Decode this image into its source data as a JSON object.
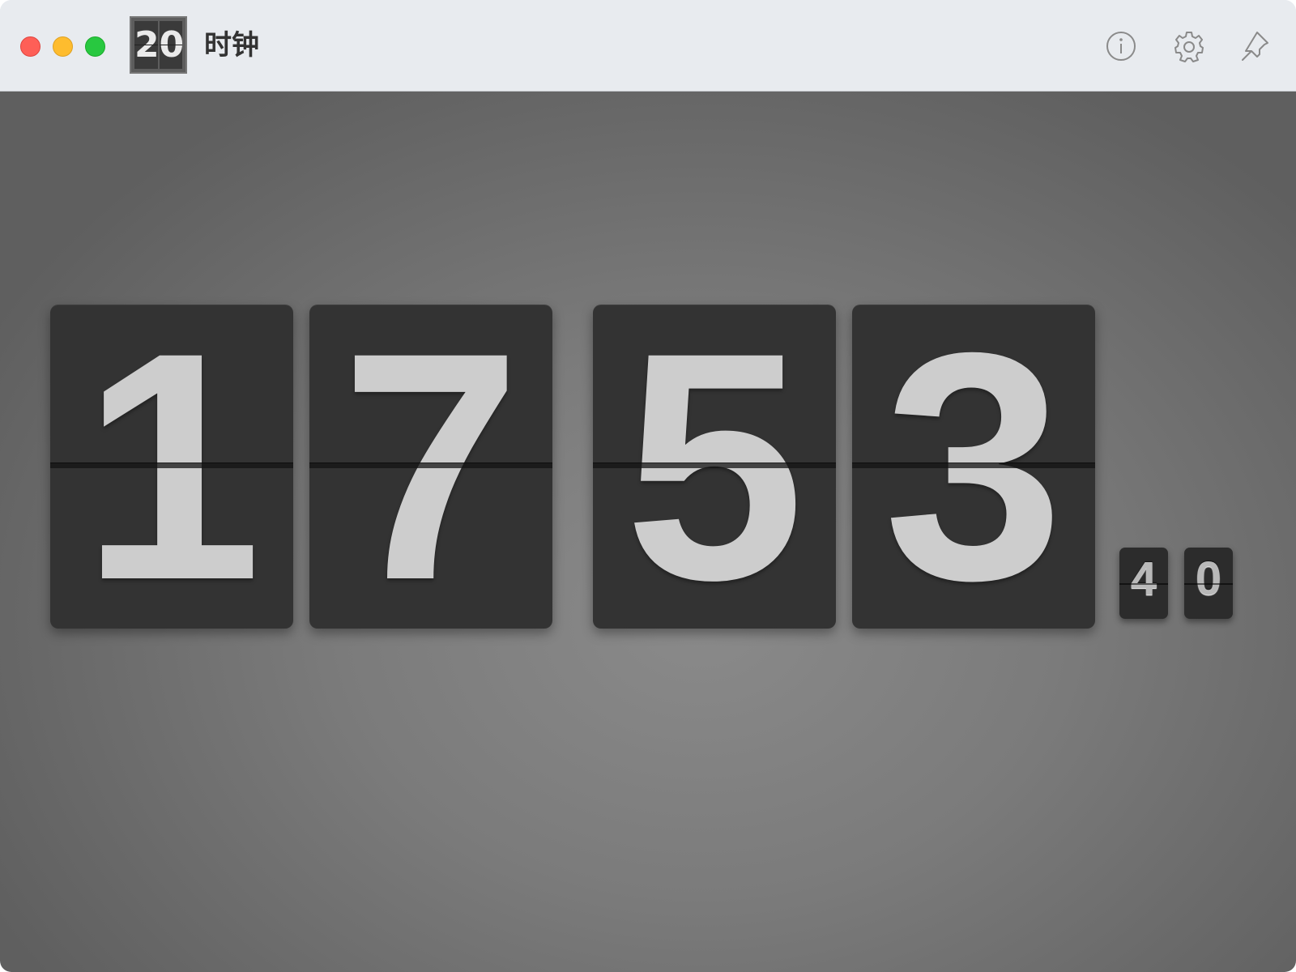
{
  "window": {
    "title": "时钟",
    "app_icon_digits": [
      "2",
      "0"
    ]
  },
  "titlebar": {
    "buttons": [
      {
        "icon": "info-icon"
      },
      {
        "icon": "gear-icon"
      },
      {
        "icon": "pin-icon"
      }
    ]
  },
  "clock": {
    "hours": [
      "1",
      "7"
    ],
    "minutes": [
      "5",
      "3"
    ],
    "seconds": [
      "4",
      "0"
    ]
  },
  "colors": {
    "close": "#fe5f57",
    "minimize": "#febc2e",
    "zoom": "#28c840",
    "card": "#333333",
    "digit": "#cdcdcd"
  }
}
